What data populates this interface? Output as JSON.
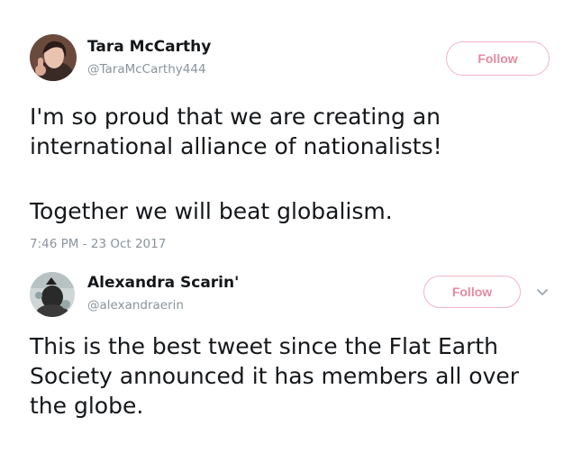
{
  "tweet": {
    "author_name": "Tara McCarthy",
    "author_handle": "@TaraMcCarthy444",
    "follow_label": "Follow",
    "text_para1": "I'm so proud that we are creating an\ninternational alliance of nationalists!",
    "text_para2": "Together we will beat globalism.",
    "timestamp": "7:46 PM - 23 Oct 2017"
  },
  "reply": {
    "author_name": "Alexandra Scarin'",
    "author_handle": "@alexandraerin",
    "follow_label": "Follow",
    "text": "This is the best tweet since the Flat Earth\nSociety announced it has members all over\nthe globe."
  },
  "icons": {
    "more_options": "chevron-down-icon"
  },
  "colors": {
    "follow_accent": "#e58aa0",
    "follow_border": "#f1b6c3",
    "secondary_text": "#8a949c",
    "primary_text": "#14171a"
  }
}
